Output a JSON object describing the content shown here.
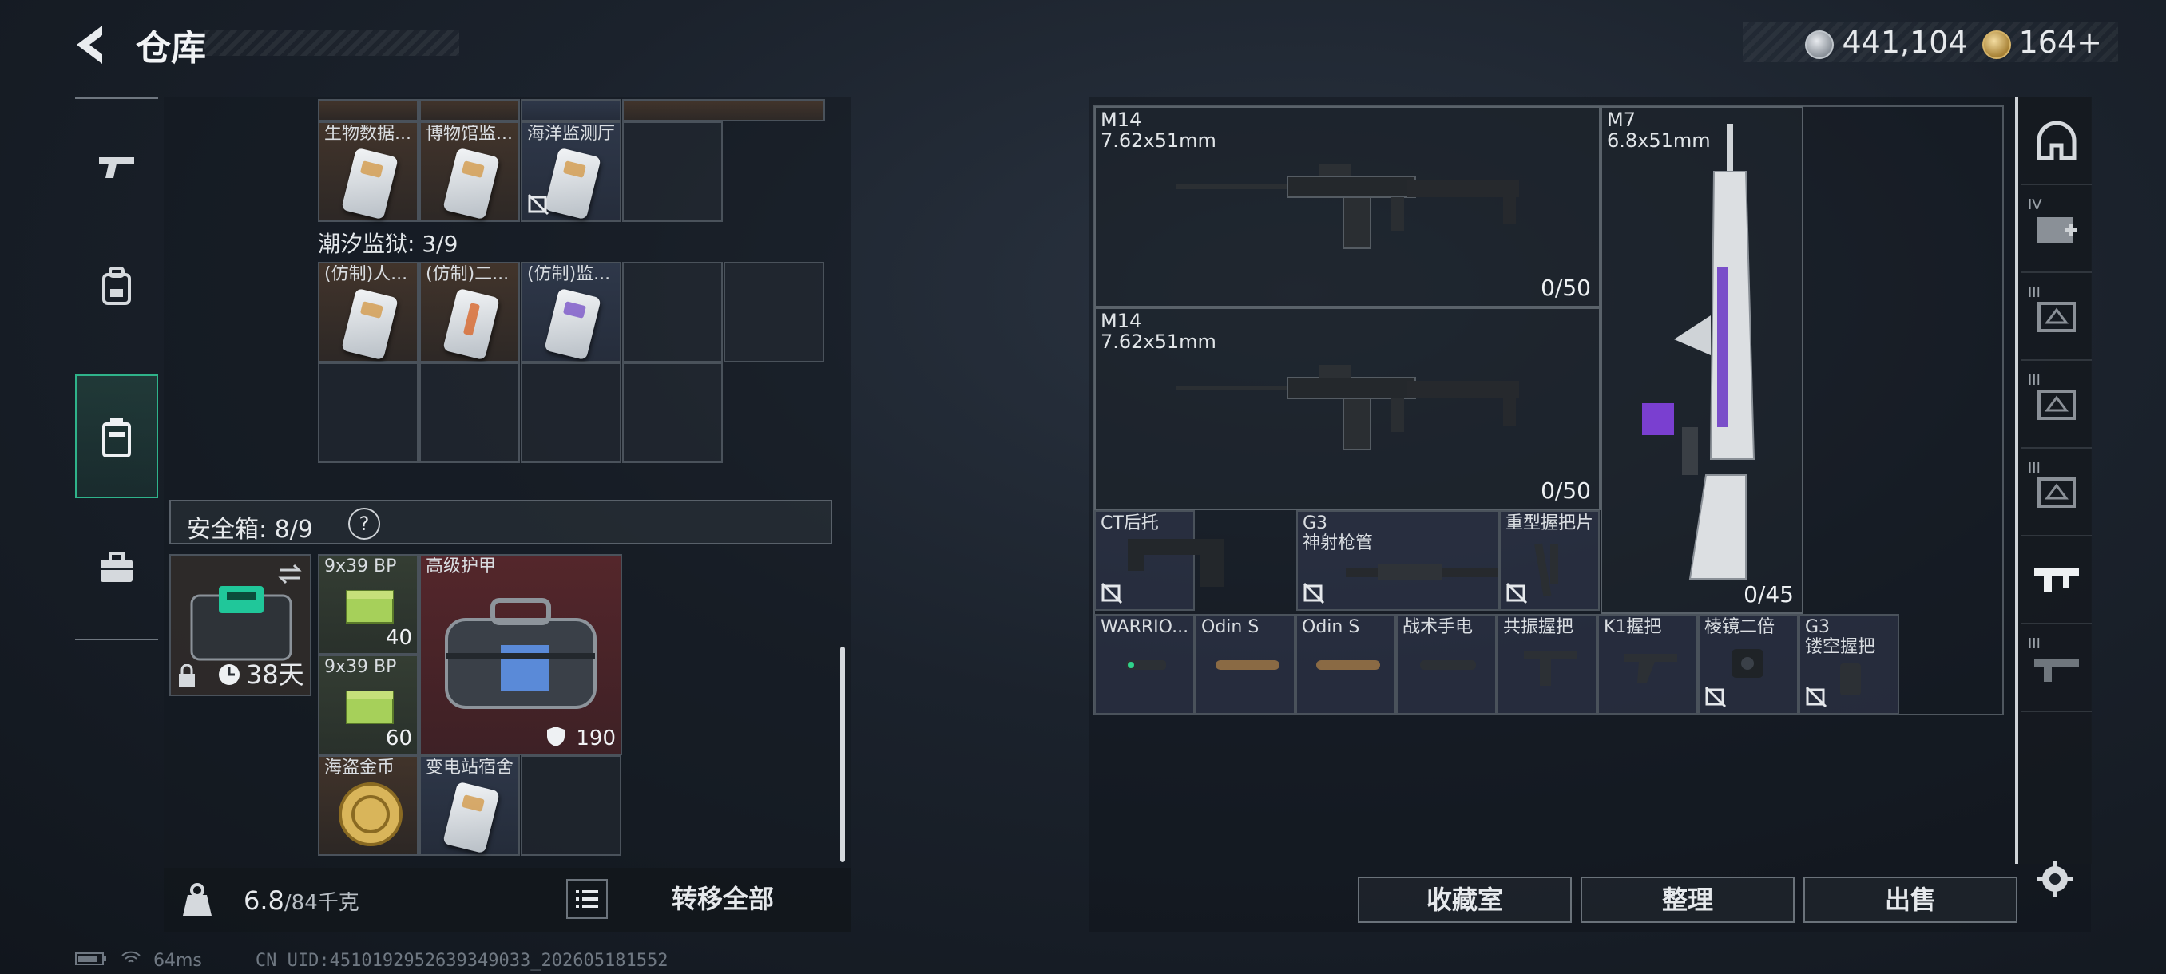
{
  "header": {
    "title": "仓库",
    "currency_silver": "441,104",
    "currency_gold": "164+"
  },
  "storage": {
    "row1": [
      {
        "label": "生物数据..."
      },
      {
        "label": "博物馆监..."
      },
      {
        "label": "海洋监测厅"
      }
    ],
    "section": "潮汐监狱: 3/9",
    "row2": [
      {
        "label": "(仿制)人..."
      },
      {
        "label": "(仿制)二..."
      },
      {
        "label": "(仿制)监..."
      }
    ]
  },
  "safe": {
    "label": "安全箱: 8/9",
    "help": "?",
    "timer": "38天",
    "items": [
      {
        "label": "9x39 BP",
        "qty": "40"
      },
      {
        "label": "9x39 BP",
        "qty": "60"
      },
      {
        "label": "高级护甲",
        "qty": "190"
      },
      {
        "label": "海盗金币"
      },
      {
        "label": "变电站宿舍"
      }
    ]
  },
  "footer": {
    "weight_current": "6.8",
    "weight_max": "/84千克",
    "transfer_label": "转移全部"
  },
  "loadout": {
    "weapons": [
      {
        "name": "M14",
        "caliber": "7.62x51mm",
        "ammo": "0/50"
      },
      {
        "name": "M14",
        "caliber": "7.62x51mm",
        "ammo": "0/50"
      },
      {
        "name": "M7",
        "caliber": "6.8x51mm",
        "ammo": "0/45"
      }
    ],
    "attachments_row1": [
      {
        "label": "CT后托"
      },
      {
        "label": "G3",
        "sub": "神射枪管"
      },
      {
        "label": "重型握把片"
      }
    ],
    "attachments_row2": [
      {
        "label": "WARRIO..."
      },
      {
        "label": "Odin S"
      },
      {
        "label": "Odin S"
      },
      {
        "label": "战术手电"
      },
      {
        "label": "共振握把"
      },
      {
        "label": "K1握把"
      },
      {
        "label": "棱镜二倍"
      },
      {
        "label": "G3",
        "sub": "镂空握把"
      }
    ]
  },
  "actions": {
    "collection": "收藏室",
    "organize": "整理",
    "sell": "出售"
  },
  "rightnav_tiers": [
    "IV",
    "III",
    "III",
    "III",
    "III"
  ],
  "status": {
    "ping": "64ms",
    "uid": "CN UID:4510192952639349033_202605181552"
  }
}
